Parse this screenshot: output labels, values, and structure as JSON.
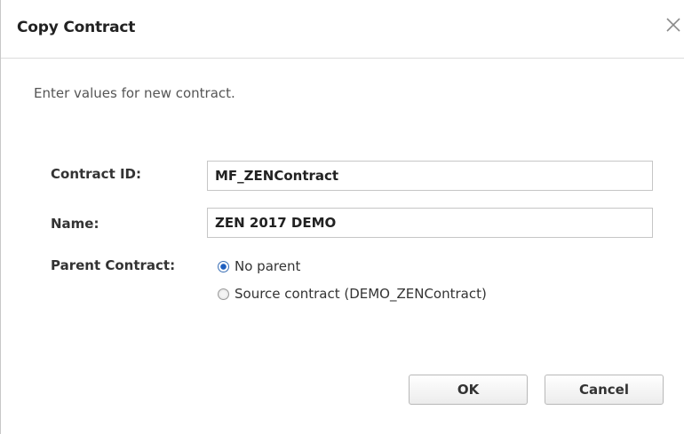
{
  "dialog": {
    "title": "Copy Contract",
    "close_icon": "close-icon",
    "intro": "Enter values for new contract."
  },
  "form": {
    "contract_id": {
      "label": "Contract ID:",
      "value": "MF_ZENContract"
    },
    "name": {
      "label": "Name:",
      "value": "ZEN 2017 DEMO"
    },
    "parent_contract": {
      "label": "Parent Contract:",
      "options": [
        {
          "label": "No parent",
          "checked": true
        },
        {
          "label": "Source contract (DEMO_ZENContract)",
          "checked": false
        }
      ]
    }
  },
  "buttons": {
    "ok": "OK",
    "cancel": "Cancel"
  },
  "colors": {
    "border": "#c6c6c6",
    "radio_accent": "#1f5fbf"
  }
}
